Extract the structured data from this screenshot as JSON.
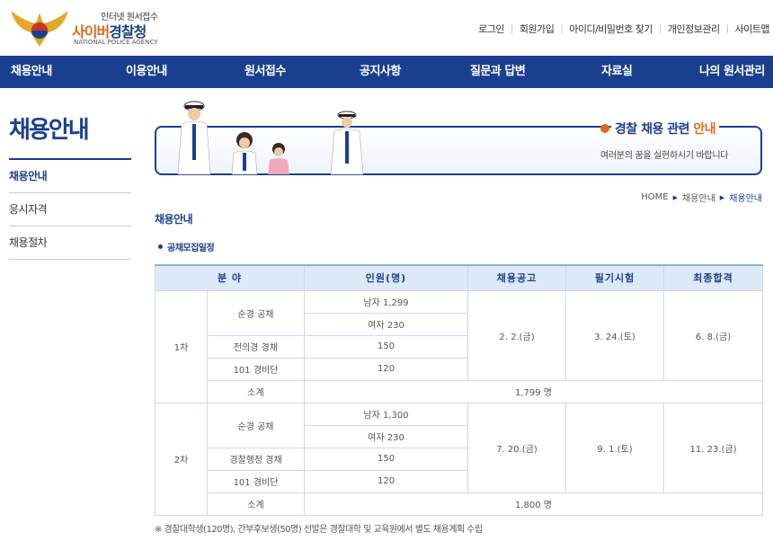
{
  "header": {
    "logo_sub": "인터넷 원서접수",
    "logo_main_a": "사이버",
    "logo_main_b": "경찰청",
    "logo_eng": "NATIONAL POLICE AGENCY",
    "util_links": [
      "로그인",
      "회원가입",
      "아이디/비밀번호 찾기",
      "개인정보관리",
      "사이트맵"
    ]
  },
  "gnb": [
    "채용안내",
    "이용안내",
    "원서접수",
    "공지사항",
    "질문과 답변",
    "자료실",
    "나의 원서관리"
  ],
  "sidebar": {
    "title": "채용안내",
    "items": [
      "채용안내",
      "응시자격",
      "채용절차"
    ]
  },
  "banner": {
    "title_a": "경찰 채용 관련 ",
    "title_b": "안내",
    "desc": "여러분의 꿈을 실현하시기 바랍니다"
  },
  "breadcrumb": [
    "HOME",
    "채용안내",
    "채용안내"
  ],
  "content": {
    "title": "채용안내",
    "subtitle": "공채모집일정"
  },
  "table": {
    "headers": [
      "분 야",
      "인원(명)",
      "채용공고",
      "필기시험",
      "최종합격"
    ],
    "round1": {
      "label": "1차",
      "r1_field": "순경 공채",
      "r1_male": "남자 1,299",
      "r1_female": "여자 230",
      "r2_field": "전의경 경채",
      "r2_count": "150",
      "r3_field": "101 경비단",
      "r3_count": "120",
      "subtotal_label": "소계",
      "subtotal": "1,799 명",
      "notice": "2. 2.(금)",
      "exam": "3. 24.(토)",
      "final": "6. 8.(금)"
    },
    "round2": {
      "label": "2차",
      "r1_field": "순경 공채",
      "r1_male": "남자 1,300",
      "r1_female": "여자 230",
      "r2_field": "경찰행정 경채",
      "r2_count": "150",
      "r3_field": "101 경비단",
      "r3_count": "120",
      "subtotal_label": "소계",
      "subtotal": "1,800 명",
      "notice": "7. 20.(금)",
      "exam": "9. 1.(토)",
      "final": "11. 23.(금)"
    }
  },
  "note": "※ 경찰대학생(120명), 간부후보생(50명) 선발은 경찰대학 및 교육원에서 별도 채용계획 수립",
  "colors": {
    "brand": "#1a3f8f",
    "accent": "#e0691b",
    "table_head": "#dce9f6"
  }
}
